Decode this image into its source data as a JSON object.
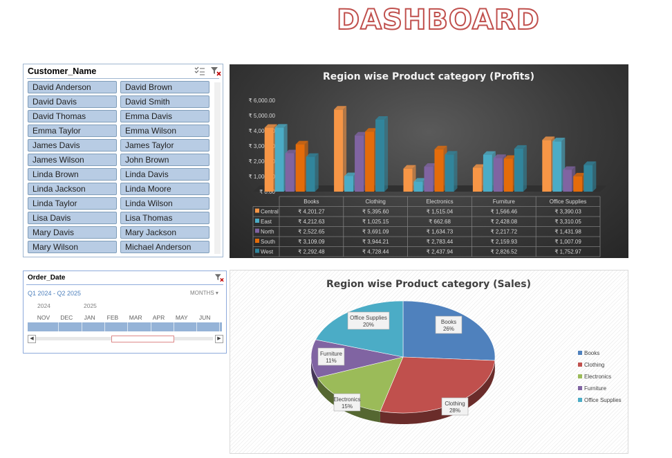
{
  "page": {
    "title": "DASHBOARD"
  },
  "slicer": {
    "title": "Customer_Name",
    "items": [
      "David Anderson",
      "David Brown",
      "David Davis",
      "David Smith",
      "David Thomas",
      "Emma Davis",
      "Emma Taylor",
      "Emma Wilson",
      "James Davis",
      "James Taylor",
      "James Wilson",
      "John Brown",
      "Linda Brown",
      "Linda Davis",
      "Linda Jackson",
      "Linda Moore",
      "Linda Taylor",
      "Linda Wilson",
      "Lisa Davis",
      "Lisa Thomas",
      "Mary Davis",
      "Mary Jackson",
      "Mary Wilson",
      "Michael Anderson"
    ]
  },
  "timeline": {
    "title": "Order_Date",
    "range_label": "Q1 2024 - Q2 2025",
    "level": "MONTHS",
    "years": [
      "2024",
      "2025"
    ],
    "months": [
      "NOV",
      "DEC",
      "JAN",
      "FEB",
      "MAR",
      "APR",
      "MAY",
      "JUN"
    ]
  },
  "colors": {
    "title_outline": "#c0504d",
    "Central": "#f79646",
    "East": "#4bacc6",
    "North": "#8064a2",
    "South": "#e46c0a",
    "West": "#31859c",
    "Books": "#4f81bd",
    "Clothing": "#c0504d",
    "Electronics": "#9bbb59",
    "Furniture": "#8064a2",
    "Office Supplies": "#4bacc6"
  },
  "chart_data": [
    {
      "type": "bar",
      "title": "Region wise Product category (Profits)",
      "categories": [
        "Books",
        "Clothing",
        "Electronics",
        "Furniture",
        "Office Supplies"
      ],
      "y_ticks": [
        "₹ 0.00",
        "₹ 1,000.00",
        "₹ 2,000.00",
        "₹ 3,000.00",
        "₹ 4,000.00",
        "₹ 5,000.00",
        "₹ 6,000.00"
      ],
      "ylim": [
        0,
        6000
      ],
      "series": [
        {
          "name": "Central",
          "values": [
            4201.27,
            5395.6,
            1515.04,
            1566.46,
            3390.03
          ],
          "labels": [
            "₹ 4,201.27",
            "₹ 5,395.60",
            "₹ 1,515.04",
            "₹ 1,566.46",
            "₹ 3,390.03"
          ]
        },
        {
          "name": "East",
          "values": [
            4212.63,
            1025.15,
            662.68,
            2428.08,
            3310.05
          ],
          "labels": [
            "₹ 4,212.63",
            "₹ 1,025.15",
            "₹ 662.68",
            "₹ 2,428.08",
            "₹ 3,310.05"
          ]
        },
        {
          "name": "North",
          "values": [
            2522.65,
            3691.09,
            1634.73,
            2217.72,
            1431.98
          ],
          "labels": [
            "₹ 2,522.65",
            "₹ 3,691.09",
            "₹ 1,634.73",
            "₹ 2,217.72",
            "₹ 1,431.98"
          ]
        },
        {
          "name": "South",
          "values": [
            3109.09,
            3944.21,
            2783.44,
            2159.93,
            1007.09
          ],
          "labels": [
            "₹ 3,109.09",
            "₹ 3,944.21",
            "₹ 2,783.44",
            "₹ 2,159.93",
            "₹ 1,007.09"
          ]
        },
        {
          "name": "West",
          "values": [
            2292.48,
            4728.44,
            2437.94,
            2826.52,
            1752.97
          ],
          "labels": [
            "₹ 2,292.48",
            "₹ 4,728.44",
            "₹ 2,437.94",
            "₹ 2,826.52",
            "₹ 1,752.97"
          ]
        }
      ],
      "data_table": true
    },
    {
      "type": "pie",
      "title": "Region wise Product category (Sales)",
      "categories": [
        "Books",
        "Clothing",
        "Electronics",
        "Furniture",
        "Office Supplies"
      ],
      "values": [
        26,
        28,
        15,
        11,
        20
      ],
      "labels": [
        "26%",
        "28%",
        "15%",
        "11%",
        "20%"
      ],
      "legend": "right"
    }
  ]
}
